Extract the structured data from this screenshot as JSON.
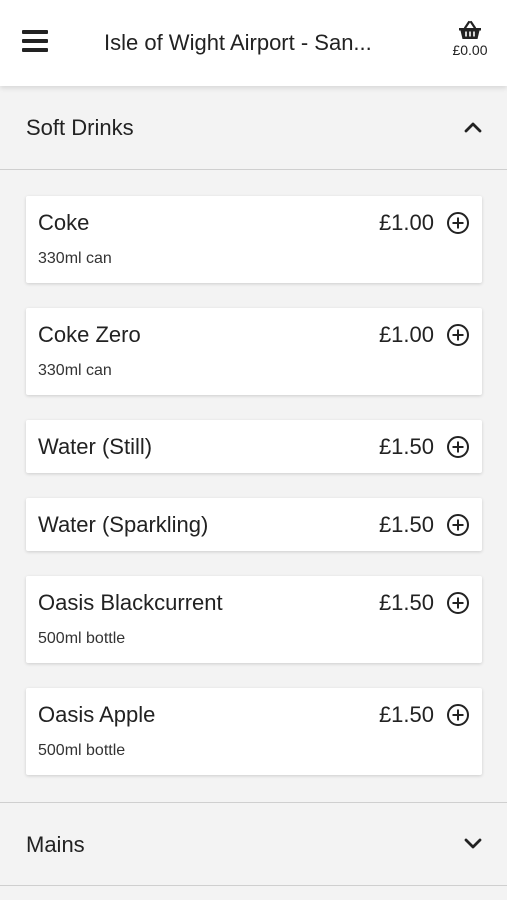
{
  "header": {
    "title": "Isle of Wight Airport - San...",
    "basket_total": "£0.00",
    "menu_icon": "hamburger-menu-icon",
    "basket_icon": "shopping-basket-icon"
  },
  "sections": [
    {
      "label": "Soft Drinks",
      "state": "expanded",
      "items": [
        {
          "name": "Coke",
          "desc": "330ml can",
          "price": "£1.00"
        },
        {
          "name": "Coke Zero",
          "desc": "330ml can",
          "price": "£1.00"
        },
        {
          "name": "Water (Still)",
          "desc": "",
          "price": "£1.50"
        },
        {
          "name": "Water (Sparkling)",
          "desc": "",
          "price": "£1.50"
        },
        {
          "name": "Oasis Blackcurrent",
          "desc": "500ml bottle",
          "price": "£1.50"
        },
        {
          "name": "Oasis Apple",
          "desc": "500ml bottle",
          "price": "£1.50"
        }
      ]
    },
    {
      "label": "Mains",
      "state": "collapsed"
    }
  ]
}
